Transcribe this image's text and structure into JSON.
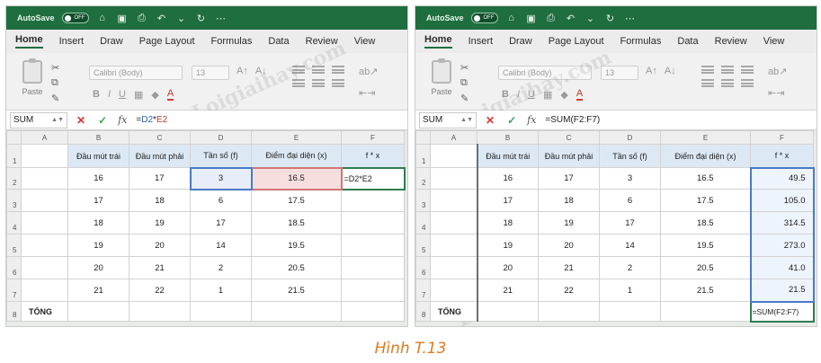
{
  "caption": "Hình T.13",
  "watermark": "Loigiaihay.com",
  "colors": {
    "title_bar": "#1e6e3f",
    "selection_blue": "#4a79c8",
    "selection_red": "#d47474",
    "caption": "#e07a1e"
  },
  "left": {
    "titlebar": {
      "autosave": "AutoSave",
      "toggle": "OFF"
    },
    "menu": [
      "Home",
      "Insert",
      "Draw",
      "Page Layout",
      "Formulas",
      "Data",
      "Review",
      "View"
    ],
    "ribbon": {
      "paste": "Paste",
      "font_name": "Calibri (Body)",
      "font_size": "13"
    },
    "formula_bar": {
      "name_box": "SUM",
      "fx": "fx",
      "formula_prefix": "=",
      "ref1": "D2",
      "op": "*",
      "ref2": "E2"
    },
    "columns": [
      "A",
      "B",
      "C",
      "D",
      "E",
      "F"
    ],
    "headers": {
      "b": "Đầu mút trái",
      "c": "Đầu mút phải",
      "d": "Tần số (f)",
      "e": "Điểm đại diện (x)",
      "f": "f * x"
    },
    "rows": [
      {
        "n": "1"
      },
      {
        "n": "2",
        "b": "16",
        "c": "17",
        "d": "3",
        "e": "16.5",
        "f": "=D2*E2"
      },
      {
        "n": "3",
        "b": "17",
        "c": "18",
        "d": "6",
        "e": "17.5",
        "f": ""
      },
      {
        "n": "4",
        "b": "18",
        "c": "19",
        "d": "17",
        "e": "18.5",
        "f": ""
      },
      {
        "n": "5",
        "b": "19",
        "c": "20",
        "d": "14",
        "e": "19.5",
        "f": ""
      },
      {
        "n": "6",
        "b": "20",
        "c": "21",
        "d": "2",
        "e": "20.5",
        "f": ""
      },
      {
        "n": "7",
        "b": "21",
        "c": "22",
        "d": "1",
        "e": "21.5",
        "f": ""
      },
      {
        "n": "8",
        "a": "TỔNG"
      }
    ]
  },
  "right": {
    "titlebar": {
      "autosave": "AutoSave",
      "toggle": "OFF"
    },
    "menu": [
      "Home",
      "Insert",
      "Draw",
      "Page Layout",
      "Formulas",
      "Data",
      "Review",
      "View"
    ],
    "ribbon": {
      "paste": "Paste",
      "font_name": "Calibri (Body)",
      "font_size": "13"
    },
    "formula_bar": {
      "name_box": "SUM",
      "fx": "fx",
      "formula": "=SUM(F2:F7)"
    },
    "columns": [
      "A",
      "B",
      "C",
      "D",
      "E",
      "F"
    ],
    "headers": {
      "b": "Đầu mút trái",
      "c": "Đầu mút phải",
      "d": "Tần số (f)",
      "e": "Điểm đại diện (x)",
      "f": "f * x"
    },
    "rows": [
      {
        "n": "1"
      },
      {
        "n": "2",
        "b": "16",
        "c": "17",
        "d": "3",
        "e": "16.5",
        "f": "49.5"
      },
      {
        "n": "3",
        "b": "17",
        "c": "18",
        "d": "6",
        "e": "17.5",
        "f": "105.0"
      },
      {
        "n": "4",
        "b": "18",
        "c": "19",
        "d": "17",
        "e": "18.5",
        "f": "314.5"
      },
      {
        "n": "5",
        "b": "19",
        "c": "20",
        "d": "14",
        "e": "19.5",
        "f": "273.0"
      },
      {
        "n": "6",
        "b": "20",
        "c": "21",
        "d": "2",
        "e": "20.5",
        "f": "41.0"
      },
      {
        "n": "7",
        "b": "21",
        "c": "22",
        "d": "1",
        "e": "21.5",
        "f": "21.5"
      },
      {
        "n": "8",
        "a": "TỔNG",
        "f": "=SUM(F2:F7)"
      }
    ]
  }
}
